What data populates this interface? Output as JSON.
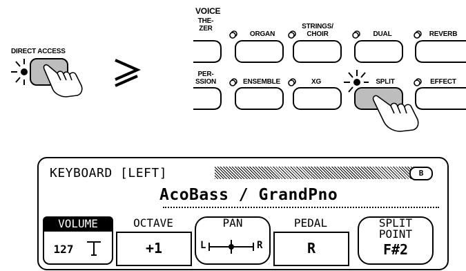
{
  "panel": {
    "voice_heading": "VOICE",
    "direct_access_label": "DIRECT ACCESS",
    "buttons_row1": [
      {
        "line1": "THE-",
        "line2": "ZER"
      },
      {
        "line1": "",
        "line2": "ORGAN"
      },
      {
        "line1": "STRINGS/",
        "line2": "CHOIR"
      },
      {
        "line1": "",
        "line2": "DUAL"
      },
      {
        "line1": "",
        "line2": "REVERB"
      }
    ],
    "buttons_row2": [
      {
        "line1": "PER-",
        "line2": "SSION"
      },
      {
        "line1": "",
        "line2": "ENSEMBLE"
      },
      {
        "line1": "",
        "line2": "XG"
      },
      {
        "line1": "",
        "line2": "SPLIT"
      },
      {
        "line1": "",
        "line2": "EFFECT"
      }
    ],
    "arrow_glyph": "≥"
  },
  "lcd": {
    "title": "KEYBOARD [LEFT]",
    "page_badge": "B",
    "voices_text": "AcoBass / GrandPno",
    "params": {
      "volume": {
        "label": "VOLUME",
        "value": "127"
      },
      "octave": {
        "label": "OCTAVE",
        "value": "+1"
      },
      "pan": {
        "label": "PAN",
        "left": "L",
        "right": "R"
      },
      "pedal": {
        "label": "PEDAL",
        "value": "R"
      },
      "split_point": {
        "label_line1": "SPLIT",
        "label_line2": "POINT",
        "value": "F#2"
      }
    }
  }
}
